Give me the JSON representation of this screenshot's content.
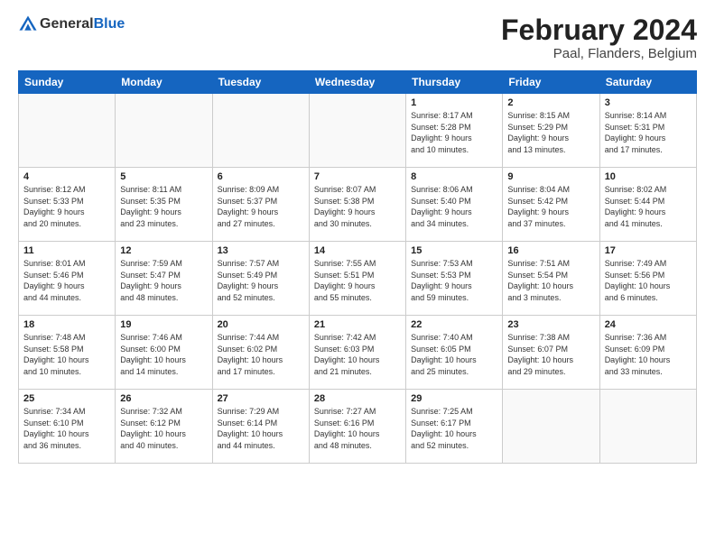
{
  "header": {
    "logo_line1": "General",
    "logo_line2": "Blue",
    "month": "February 2024",
    "location": "Paal, Flanders, Belgium"
  },
  "weekdays": [
    "Sunday",
    "Monday",
    "Tuesday",
    "Wednesday",
    "Thursday",
    "Friday",
    "Saturday"
  ],
  "weeks": [
    [
      {
        "day": "",
        "info": ""
      },
      {
        "day": "",
        "info": ""
      },
      {
        "day": "",
        "info": ""
      },
      {
        "day": "",
        "info": ""
      },
      {
        "day": "1",
        "info": "Sunrise: 8:17 AM\nSunset: 5:28 PM\nDaylight: 9 hours\nand 10 minutes."
      },
      {
        "day": "2",
        "info": "Sunrise: 8:15 AM\nSunset: 5:29 PM\nDaylight: 9 hours\nand 13 minutes."
      },
      {
        "day": "3",
        "info": "Sunrise: 8:14 AM\nSunset: 5:31 PM\nDaylight: 9 hours\nand 17 minutes."
      }
    ],
    [
      {
        "day": "4",
        "info": "Sunrise: 8:12 AM\nSunset: 5:33 PM\nDaylight: 9 hours\nand 20 minutes."
      },
      {
        "day": "5",
        "info": "Sunrise: 8:11 AM\nSunset: 5:35 PM\nDaylight: 9 hours\nand 23 minutes."
      },
      {
        "day": "6",
        "info": "Sunrise: 8:09 AM\nSunset: 5:37 PM\nDaylight: 9 hours\nand 27 minutes."
      },
      {
        "day": "7",
        "info": "Sunrise: 8:07 AM\nSunset: 5:38 PM\nDaylight: 9 hours\nand 30 minutes."
      },
      {
        "day": "8",
        "info": "Sunrise: 8:06 AM\nSunset: 5:40 PM\nDaylight: 9 hours\nand 34 minutes."
      },
      {
        "day": "9",
        "info": "Sunrise: 8:04 AM\nSunset: 5:42 PM\nDaylight: 9 hours\nand 37 minutes."
      },
      {
        "day": "10",
        "info": "Sunrise: 8:02 AM\nSunset: 5:44 PM\nDaylight: 9 hours\nand 41 minutes."
      }
    ],
    [
      {
        "day": "11",
        "info": "Sunrise: 8:01 AM\nSunset: 5:46 PM\nDaylight: 9 hours\nand 44 minutes."
      },
      {
        "day": "12",
        "info": "Sunrise: 7:59 AM\nSunset: 5:47 PM\nDaylight: 9 hours\nand 48 minutes."
      },
      {
        "day": "13",
        "info": "Sunrise: 7:57 AM\nSunset: 5:49 PM\nDaylight: 9 hours\nand 52 minutes."
      },
      {
        "day": "14",
        "info": "Sunrise: 7:55 AM\nSunset: 5:51 PM\nDaylight: 9 hours\nand 55 minutes."
      },
      {
        "day": "15",
        "info": "Sunrise: 7:53 AM\nSunset: 5:53 PM\nDaylight: 9 hours\nand 59 minutes."
      },
      {
        "day": "16",
        "info": "Sunrise: 7:51 AM\nSunset: 5:54 PM\nDaylight: 10 hours\nand 3 minutes."
      },
      {
        "day": "17",
        "info": "Sunrise: 7:49 AM\nSunset: 5:56 PM\nDaylight: 10 hours\nand 6 minutes."
      }
    ],
    [
      {
        "day": "18",
        "info": "Sunrise: 7:48 AM\nSunset: 5:58 PM\nDaylight: 10 hours\nand 10 minutes."
      },
      {
        "day": "19",
        "info": "Sunrise: 7:46 AM\nSunset: 6:00 PM\nDaylight: 10 hours\nand 14 minutes."
      },
      {
        "day": "20",
        "info": "Sunrise: 7:44 AM\nSunset: 6:02 PM\nDaylight: 10 hours\nand 17 minutes."
      },
      {
        "day": "21",
        "info": "Sunrise: 7:42 AM\nSunset: 6:03 PM\nDaylight: 10 hours\nand 21 minutes."
      },
      {
        "day": "22",
        "info": "Sunrise: 7:40 AM\nSunset: 6:05 PM\nDaylight: 10 hours\nand 25 minutes."
      },
      {
        "day": "23",
        "info": "Sunrise: 7:38 AM\nSunset: 6:07 PM\nDaylight: 10 hours\nand 29 minutes."
      },
      {
        "day": "24",
        "info": "Sunrise: 7:36 AM\nSunset: 6:09 PM\nDaylight: 10 hours\nand 33 minutes."
      }
    ],
    [
      {
        "day": "25",
        "info": "Sunrise: 7:34 AM\nSunset: 6:10 PM\nDaylight: 10 hours\nand 36 minutes."
      },
      {
        "day": "26",
        "info": "Sunrise: 7:32 AM\nSunset: 6:12 PM\nDaylight: 10 hours\nand 40 minutes."
      },
      {
        "day": "27",
        "info": "Sunrise: 7:29 AM\nSunset: 6:14 PM\nDaylight: 10 hours\nand 44 minutes."
      },
      {
        "day": "28",
        "info": "Sunrise: 7:27 AM\nSunset: 6:16 PM\nDaylight: 10 hours\nand 48 minutes."
      },
      {
        "day": "29",
        "info": "Sunrise: 7:25 AM\nSunset: 6:17 PM\nDaylight: 10 hours\nand 52 minutes."
      },
      {
        "day": "",
        "info": ""
      },
      {
        "day": "",
        "info": ""
      }
    ]
  ]
}
